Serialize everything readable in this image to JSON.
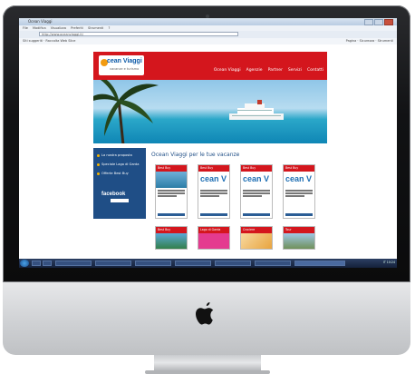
{
  "browser": {
    "window_title": "Ocean Viaggi",
    "menu": [
      "File",
      "Modifica",
      "Visualizza",
      "Preferiti",
      "Strumenti",
      "?"
    ],
    "address": "http://www.oceanviaggi.it/",
    "bookmarks": "Siti suggeriti · Raccolta Web Slice",
    "bookmarks_right": "Pagina · Sicurezza · Strumenti"
  },
  "site": {
    "logo_text": "cean Viaggi",
    "logo_sub": "vacanze e turismo",
    "nav": [
      "Ocean Viaggi",
      "Agenzie",
      "Partner",
      "Servizi",
      "Contatti"
    ],
    "sidebar": [
      "La nostra proposta",
      "Speciale Lago di Garda",
      "Offerte Best Buy"
    ],
    "facebook_label": "facebook",
    "main_title": "Ocean Viaggi per le tue vacanze",
    "cards_row1": [
      {
        "head": "Best Buy",
        "kind": "photo"
      },
      {
        "head": "Best Buy",
        "kind": "logo",
        "logo": "cean V"
      },
      {
        "head": "Best Buy",
        "kind": "logo",
        "logo": "cean V"
      },
      {
        "head": "Best Buy",
        "kind": "logo",
        "logo": "cean V"
      }
    ],
    "cards_row2": [
      {
        "head": "Best Buy"
      },
      {
        "head": "Lago di Garda"
      },
      {
        "head": "Crociere"
      },
      {
        "head": "Tour"
      }
    ]
  },
  "taskbar": {
    "tray": "IT  10:24"
  },
  "colors": {
    "brand_red": "#d4161d",
    "brand_blue": "#1f4e86",
    "accent_orange": "#f29b11"
  }
}
